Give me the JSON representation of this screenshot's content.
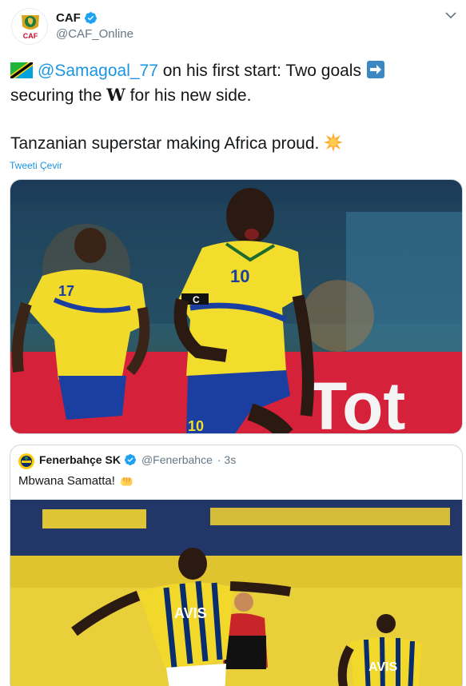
{
  "tweet": {
    "display_name": "CAF",
    "handle": "@CAF_Online",
    "avatar_text": "CAF",
    "text": {
      "mention": "@Samagoal_77",
      "line1_rest": " on his first start: Two goals",
      "line2_pre": "securing the ",
      "line2_bold": "W",
      "line2_post": " for his new side.",
      "line3": "Tanzanian superstar making Africa proud."
    },
    "translate_label": "Tweeti Çevir",
    "photo": {
      "jersey_number_main": "10",
      "jersey_number_left": "17",
      "jersey_number_bottom": "10",
      "captain_band": "C",
      "board_text": "Tot"
    },
    "icons": {
      "flag": "tanzania-flag-icon",
      "arrow": "right-arrow-icon",
      "star": "glowing-star-icon",
      "verified": "verified-badge-icon",
      "caret": "chevron-down-icon"
    }
  },
  "quoted_tweet": {
    "display_name": "Fenerbahçe SK",
    "handle": "@Fenerbahce",
    "time": "· 3s",
    "text": "Mbwana Samatta!",
    "icons": {
      "verified": "verified-badge-icon",
      "fist": "oncoming-fist-icon"
    },
    "photo": {
      "shirt_sponsor": "AVIS",
      "shirt_sponsor_right": "AVIS"
    }
  },
  "colors": {
    "link": "#1b95e0",
    "text": "#14171a",
    "muted": "#657786",
    "border": "#ccd6dd"
  }
}
